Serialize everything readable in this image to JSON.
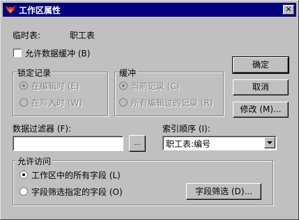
{
  "title": "工作区属性",
  "temp_table": {
    "label": "临时表:",
    "value": "职工表"
  },
  "allow_buffer": {
    "label": "允许数据缓冲 (B)",
    "checked": false
  },
  "lock_group": {
    "label": "锁定记录",
    "options": [
      {
        "label": "在编辑时 (E)",
        "selected": true
      },
      {
        "label": "在写入时 (W)",
        "selected": false
      }
    ]
  },
  "buffer_group": {
    "label": "缓冲",
    "options": [
      {
        "label": "当前记录 (C)",
        "selected": true
      },
      {
        "label": "所有编辑过的记录 (R)",
        "selected": false
      }
    ]
  },
  "buttons": {
    "ok": "确定",
    "cancel": "取消",
    "modify": "修改 (M)..."
  },
  "data_filter": {
    "label": "数据过滤器 (F):",
    "value": "",
    "builder_label": "..."
  },
  "index_order": {
    "label": "索引顺序 (I):",
    "value": "职工表:编号"
  },
  "access_group": {
    "label": "允许访问",
    "options": [
      {
        "label": "工作区中的所有字段 (L)",
        "selected": true
      },
      {
        "label": "字段筛选指定的字段 (O)",
        "selected": false
      }
    ],
    "field_filter_button": "字段筛选 (D)..."
  }
}
